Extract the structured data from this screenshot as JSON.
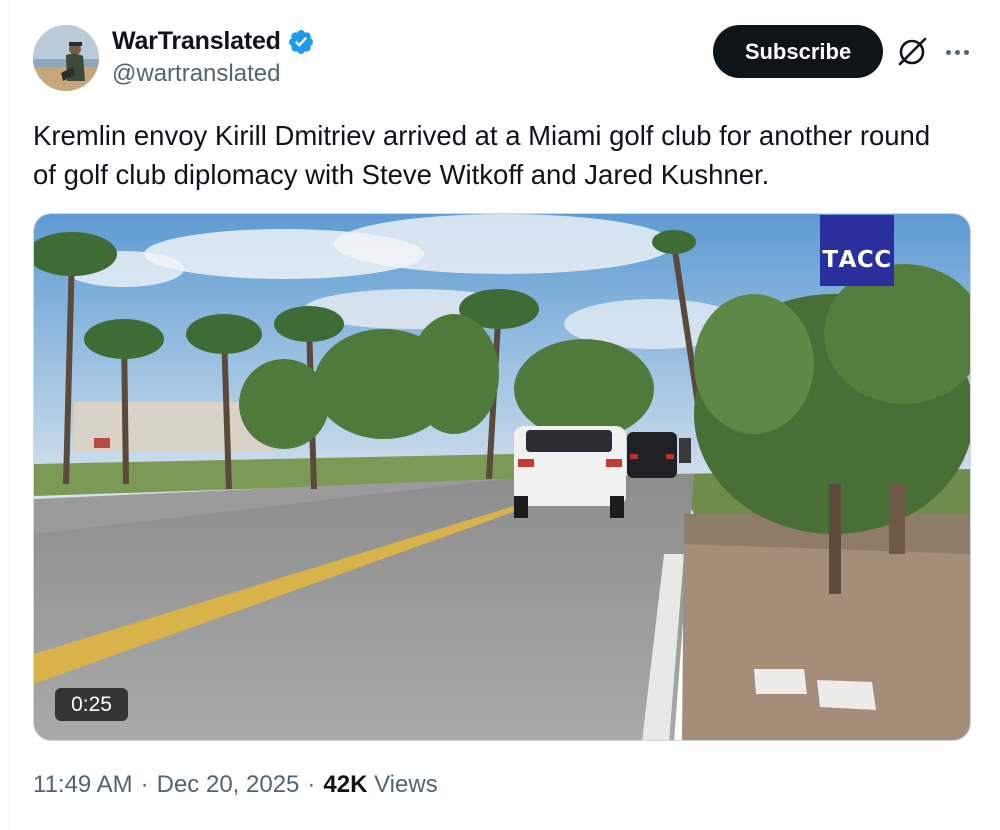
{
  "author": {
    "display_name": "WarTranslated",
    "handle": "@wartranslated",
    "verified": true,
    "verified_color": "#1d9bf0"
  },
  "actions": {
    "subscribe_label": "Subscribe",
    "grok_icon": "grok-icon",
    "more_icon": "more-icon"
  },
  "tweet": {
    "text": "Kremlin envoy Kirill Dmitriev arrived at a Miami golf club for another round of golf club diplomacy with Steve Witkoff and Jared Kushner."
  },
  "media": {
    "type": "video",
    "watermark": "ТАСС",
    "watermark_color": "#2b2f9e",
    "duration": "0:25"
  },
  "meta": {
    "time": "11:49 AM",
    "separator": "·",
    "date": "Dec 20, 2025",
    "views_count": "42K",
    "views_label": "Views"
  },
  "colors": {
    "text_primary": "#0f1419",
    "text_secondary": "#536471",
    "button_bg": "#0f1419"
  }
}
